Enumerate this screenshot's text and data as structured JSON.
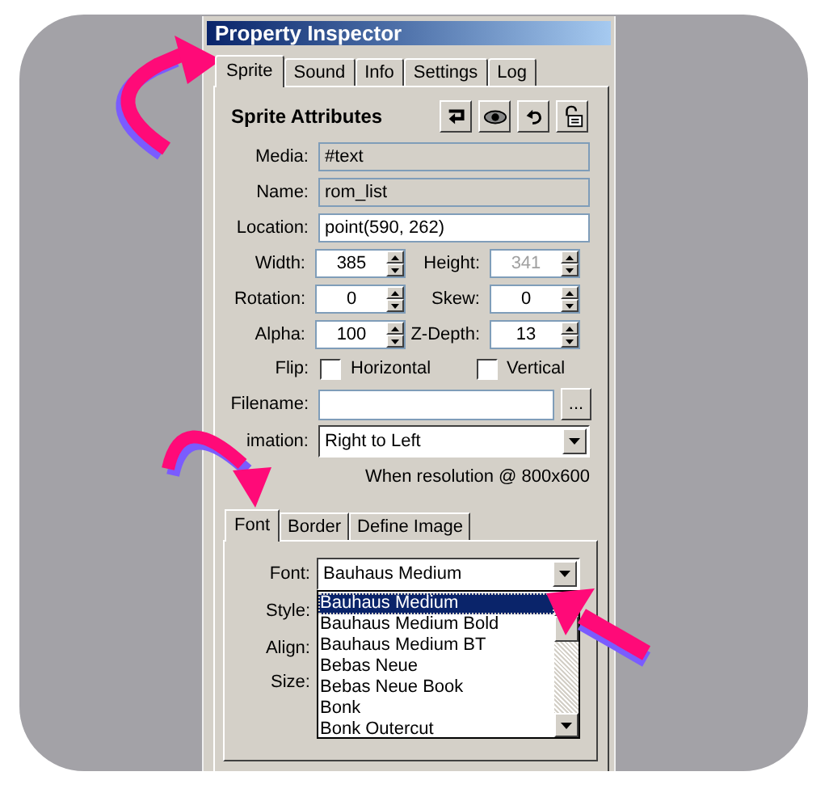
{
  "window": {
    "title": "Property Inspector"
  },
  "tabs": [
    {
      "label": "Sprite",
      "selected": true
    },
    {
      "label": "Sound",
      "selected": false
    },
    {
      "label": "Info",
      "selected": false
    },
    {
      "label": "Settings",
      "selected": false
    },
    {
      "label": "Log",
      "selected": false
    }
  ],
  "section_title": "Sprite Attributes",
  "fields": [
    {
      "label": "Media:",
      "value": "#text",
      "kind": "readonly"
    },
    {
      "label": "Name:",
      "value": "rom_list",
      "kind": "readonly"
    },
    {
      "label": "Location:",
      "value": "point(590, 262)",
      "kind": "text"
    }
  ],
  "spinners": [
    {
      "label": "Width:",
      "value": "385",
      "disabled": false
    },
    {
      "label": "Height:",
      "value": "341",
      "disabled": true
    },
    {
      "label": "Rotation:",
      "value": "0",
      "disabled": false
    },
    {
      "label": "Skew:",
      "value": "0",
      "disabled": false
    },
    {
      "label": "Alpha:",
      "value": "100",
      "disabled": false
    },
    {
      "label": "Z-Depth:",
      "value": "13",
      "disabled": false
    }
  ],
  "flip": {
    "label": "Flip:",
    "options": [
      {
        "label": "Horizontal",
        "checked": false
      },
      {
        "label": "Vertical",
        "checked": false
      }
    ]
  },
  "filename": {
    "label": "Filename:",
    "button": "..."
  },
  "animation": {
    "label": "imation:",
    "value": "Right to Left"
  },
  "resolution_note": "When resolution @ 800x600",
  "sub_tabs": [
    {
      "label": "Font",
      "selected": true
    },
    {
      "label": "Border",
      "selected": false
    },
    {
      "label": "Define Image",
      "selected": false
    }
  ],
  "font": {
    "label": "Font:",
    "value": "Bauhaus Medium"
  },
  "font_list": [
    {
      "label": "Bauhaus Medium",
      "selected": true
    },
    {
      "label": "Bauhaus Medium Bold",
      "selected": false
    },
    {
      "label": "Bauhaus Medium BT",
      "selected": false
    },
    {
      "label": "Bebas Neue",
      "selected": false
    },
    {
      "label": "Bebas Neue Book",
      "selected": false
    },
    {
      "label": "Bonk",
      "selected": false
    },
    {
      "label": "Bonk Outercut",
      "selected": false
    }
  ],
  "other_labels": [
    "Style:",
    "Align:",
    "Size:"
  ]
}
